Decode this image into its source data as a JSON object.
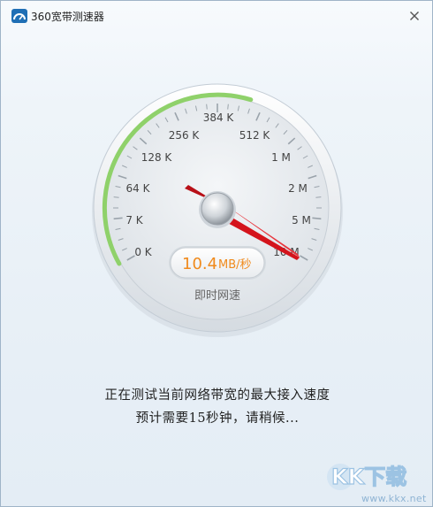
{
  "window": {
    "title": "360宽带测速器"
  },
  "gauge": {
    "scale_labels": [
      "0 K",
      "7 K",
      "64 K",
      "128 K",
      "256 K",
      "384 K",
      "512 K",
      "1 M",
      "2 M",
      "5 M",
      "10 M"
    ],
    "speed_value": "10.4",
    "speed_unit": "MB/秒",
    "caption": "即时网速",
    "needle_position": "10 M"
  },
  "status": {
    "line1": "正在测试当前网络带宽的最大接入速度",
    "line2": "预计需要15秒钟，请稍候..."
  },
  "watermark": {
    "brand": "KK下载",
    "url": "www.kkx.net"
  },
  "colors": {
    "accent_green": "#8fd16a",
    "needle_red": "#d4141c",
    "speed_orange": "#f08a1c"
  },
  "icons": {
    "app": "speedometer-icon",
    "close": "close-icon"
  }
}
